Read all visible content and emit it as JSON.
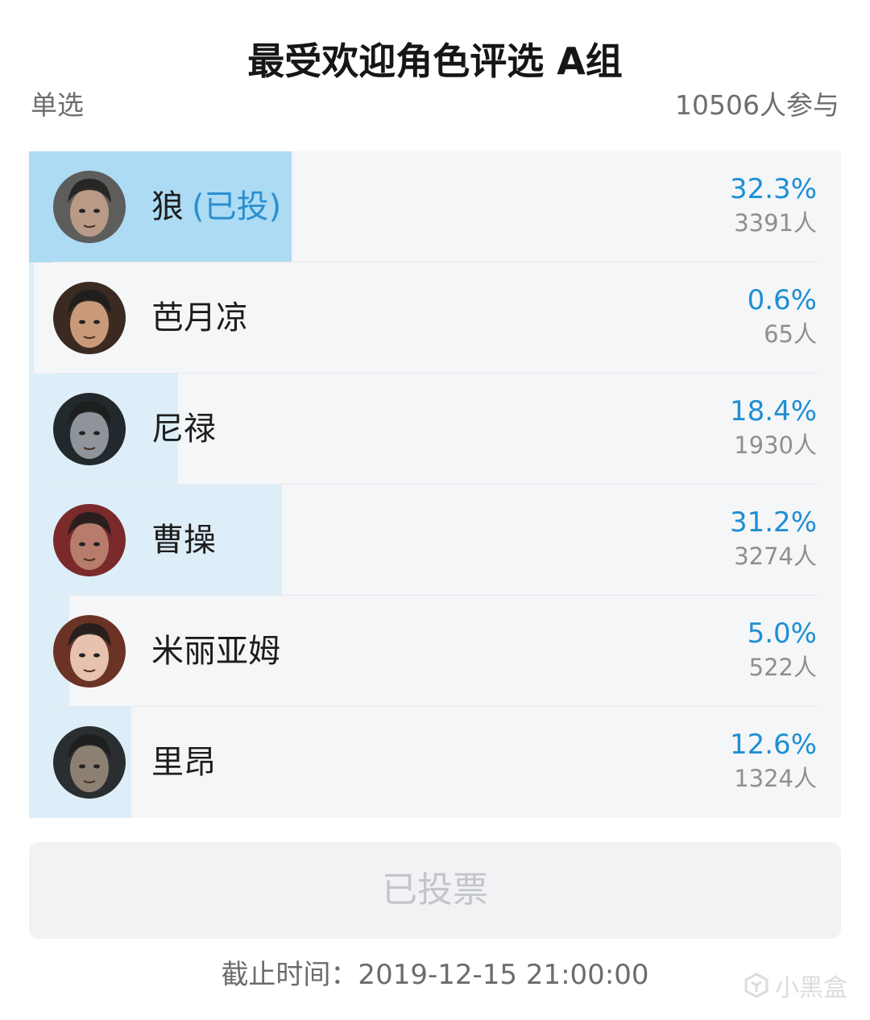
{
  "poll": {
    "title": "最受欢迎角色评选 A组",
    "mode": "单选",
    "participants": "10506人参与"
  },
  "options": [
    {
      "name": "狼",
      "tag": "(已投)",
      "percent": "32.3%",
      "count": "3391人",
      "share": 0.323,
      "voted": true,
      "avatar": "wolf-avatar",
      "skin": "#b89a86",
      "bg": "#5d5d5b"
    },
    {
      "name": "芭月凉",
      "tag": "",
      "percent": "0.6%",
      "count": "65人",
      "share": 0.006,
      "voted": false,
      "avatar": "ryo-avatar",
      "skin": "#c99a7a",
      "bg": "#3a2a22"
    },
    {
      "name": "尼禄",
      "tag": "",
      "percent": "18.4%",
      "count": "1930人",
      "share": 0.184,
      "voted": false,
      "avatar": "nero-avatar",
      "skin": "#8f949a",
      "bg": "#22292d"
    },
    {
      "name": "曹操",
      "tag": "",
      "percent": "31.2%",
      "count": "3274人",
      "share": 0.312,
      "voted": false,
      "avatar": "caocao-avatar",
      "skin": "#b77c6c",
      "bg": "#7a2a2a"
    },
    {
      "name": "米丽亚姆",
      "tag": "",
      "percent": "5.0%",
      "count": "522人",
      "share": 0.05,
      "voted": false,
      "avatar": "miriam-avatar",
      "skin": "#e7c2ae",
      "bg": "#6b3325"
    },
    {
      "name": "里昂",
      "tag": "",
      "percent": "12.6%",
      "count": "1324人",
      "share": 0.126,
      "voted": false,
      "avatar": "leon-avatar",
      "skin": "#8b8072",
      "bg": "#2b2e30"
    }
  ],
  "vote_button": "已投票",
  "deadline": "截止时间：2019-12-15 21:00:00",
  "watermark": "小黑盒",
  "colors": {
    "accent": "#1d8fd3",
    "voted_fill": "#addbf4",
    "result_fill": "#deeef9",
    "panel_bg": "#f5f6f8"
  }
}
